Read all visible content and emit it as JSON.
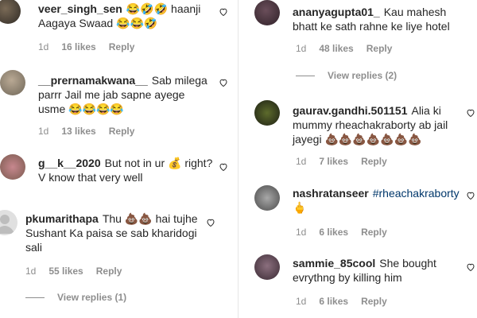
{
  "comments_left": [
    {
      "username": "veer_singh_sen",
      "text": "😂🤣🤣 haanji Aagaya Swaad 😂😂🤣",
      "time": "1d",
      "likes": "16 likes",
      "reply": "Reply"
    },
    {
      "username": "__prernamakwana__",
      "text": "Sab milega parrr Jail me jab sapne ayege usme 😂😂😂😂",
      "time": "1d",
      "likes": "13 likes",
      "reply": "Reply"
    },
    {
      "username": "g__k__2020",
      "text": "But not in ur 💰 right? V know that very well",
      "time": "",
      "likes": "",
      "reply": ""
    },
    {
      "username": "pkumarithapa",
      "text": "Thu 💩💩 hai tujhe Sushant Ka paisa se sab kharidogi sali",
      "time": "1d",
      "likes": "55 likes",
      "reply": "Reply",
      "view_replies": "View replies (1)"
    }
  ],
  "comments_right": [
    {
      "username": "ananyagupta01_",
      "text": "Kau mahesh bhatt ke sath rahne ke liye hotel",
      "time": "1d",
      "likes": "48 likes",
      "reply": "Reply",
      "view_replies": "View replies (2)"
    },
    {
      "username": "gaurav.gandhi.501151",
      "text": "Alia ki mummy rheachakraborty ab jail jayegi 💩💩💩💩💩💩💩",
      "time": "1d",
      "likes": "7 likes",
      "reply": "Reply"
    },
    {
      "username": "nashratanseer",
      "text": "#rheachakraborty",
      "text2": "🖕",
      "time": "1d",
      "likes": "6 likes",
      "reply": "Reply"
    },
    {
      "username": "sammie_85cool",
      "text": "She bought evrythng by killing him",
      "time": "1d",
      "likes": "6 likes",
      "reply": "Reply"
    }
  ],
  "colors": {
    "accent_link": "#00376b",
    "muted": "#8e8e8e",
    "text": "#262626"
  }
}
